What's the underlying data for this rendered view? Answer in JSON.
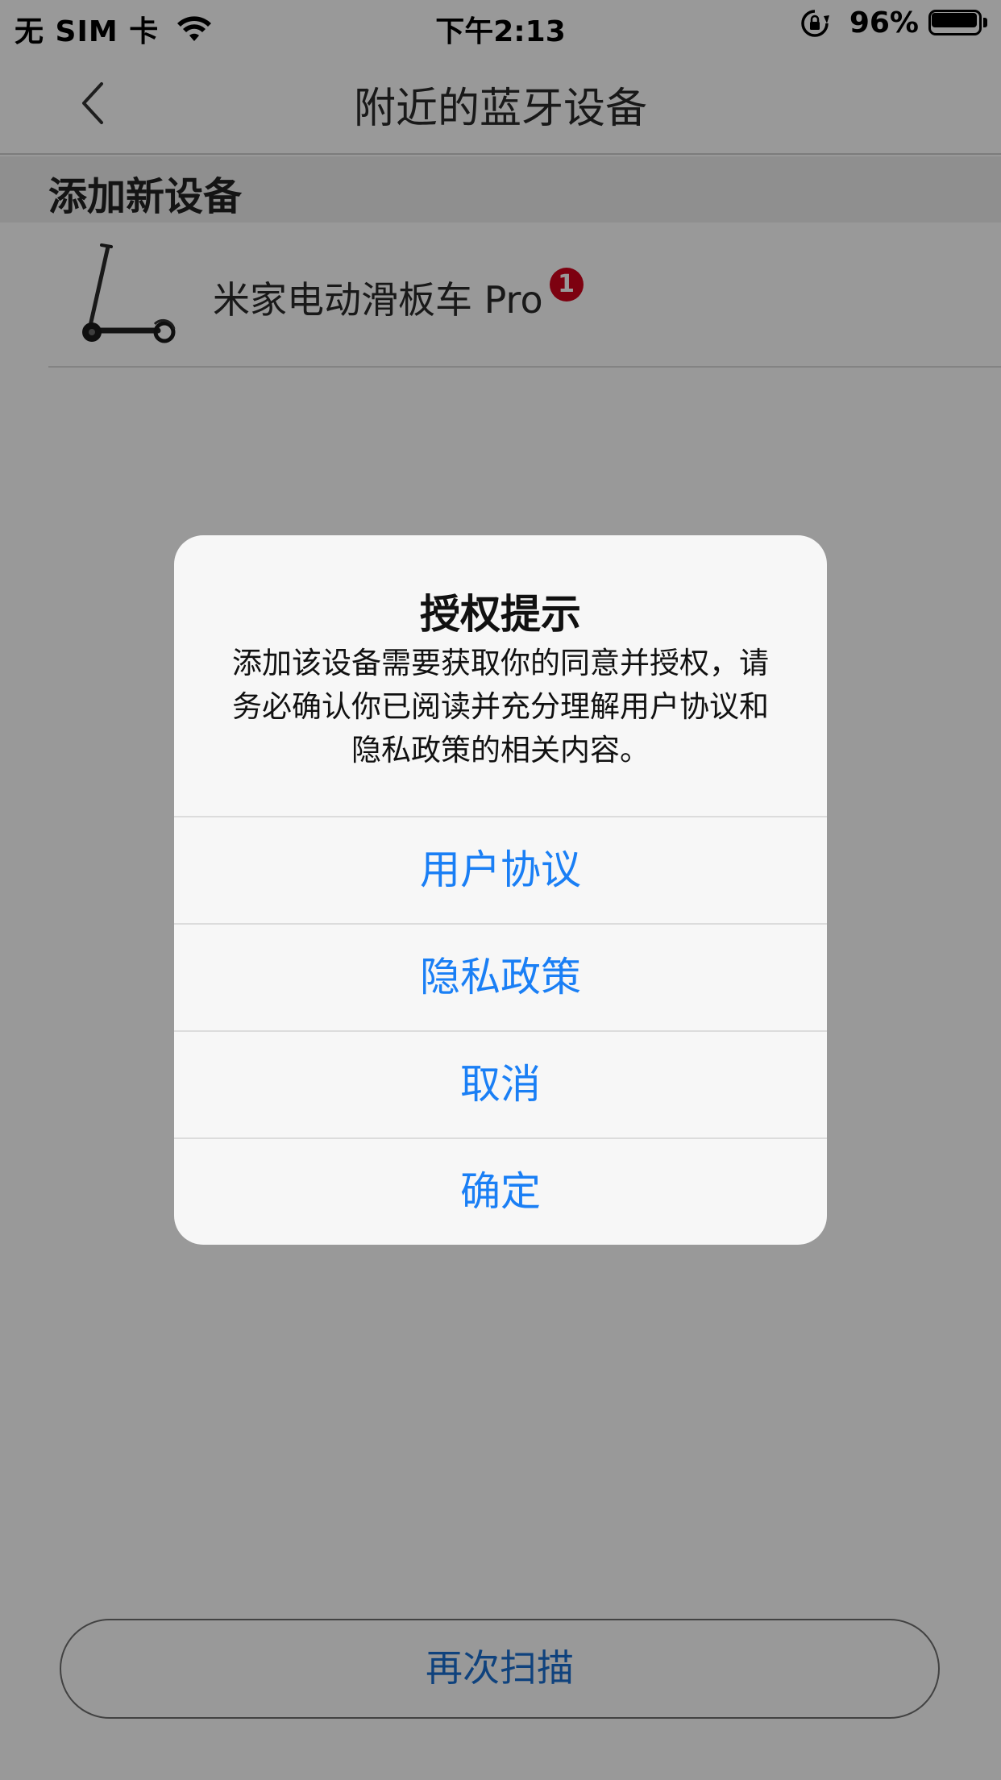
{
  "status_bar": {
    "carrier": "无 SIM 卡",
    "time": "下午2:13",
    "battery_percent": "96%",
    "battery_level": 0.96,
    "icons": [
      "wifi-icon",
      "lock-rotation-icon",
      "battery-icon"
    ]
  },
  "nav": {
    "title": "附近的蓝牙设备",
    "back_icon": "chevron-left-icon"
  },
  "section": {
    "title": "添加新设备"
  },
  "devices": [
    {
      "name": "米家电动滑板车 Pro",
      "badge": "1",
      "icon": "scooter-image"
    }
  ],
  "rescan_label": "再次扫描",
  "alert": {
    "title": "授权提示",
    "message": "添加该设备需要获取你的同意并授权，请务必确认你已阅读并充分理解用户协议和隐私政策的相关内容。",
    "buttons": [
      {
        "label": "用户协议"
      },
      {
        "label": "隐私政策"
      },
      {
        "label": "取消"
      },
      {
        "label": "确定"
      }
    ]
  },
  "colors": {
    "accent_blue": "#1a7ff5",
    "badge_red": "#d0021b",
    "overlay": "#000000"
  }
}
